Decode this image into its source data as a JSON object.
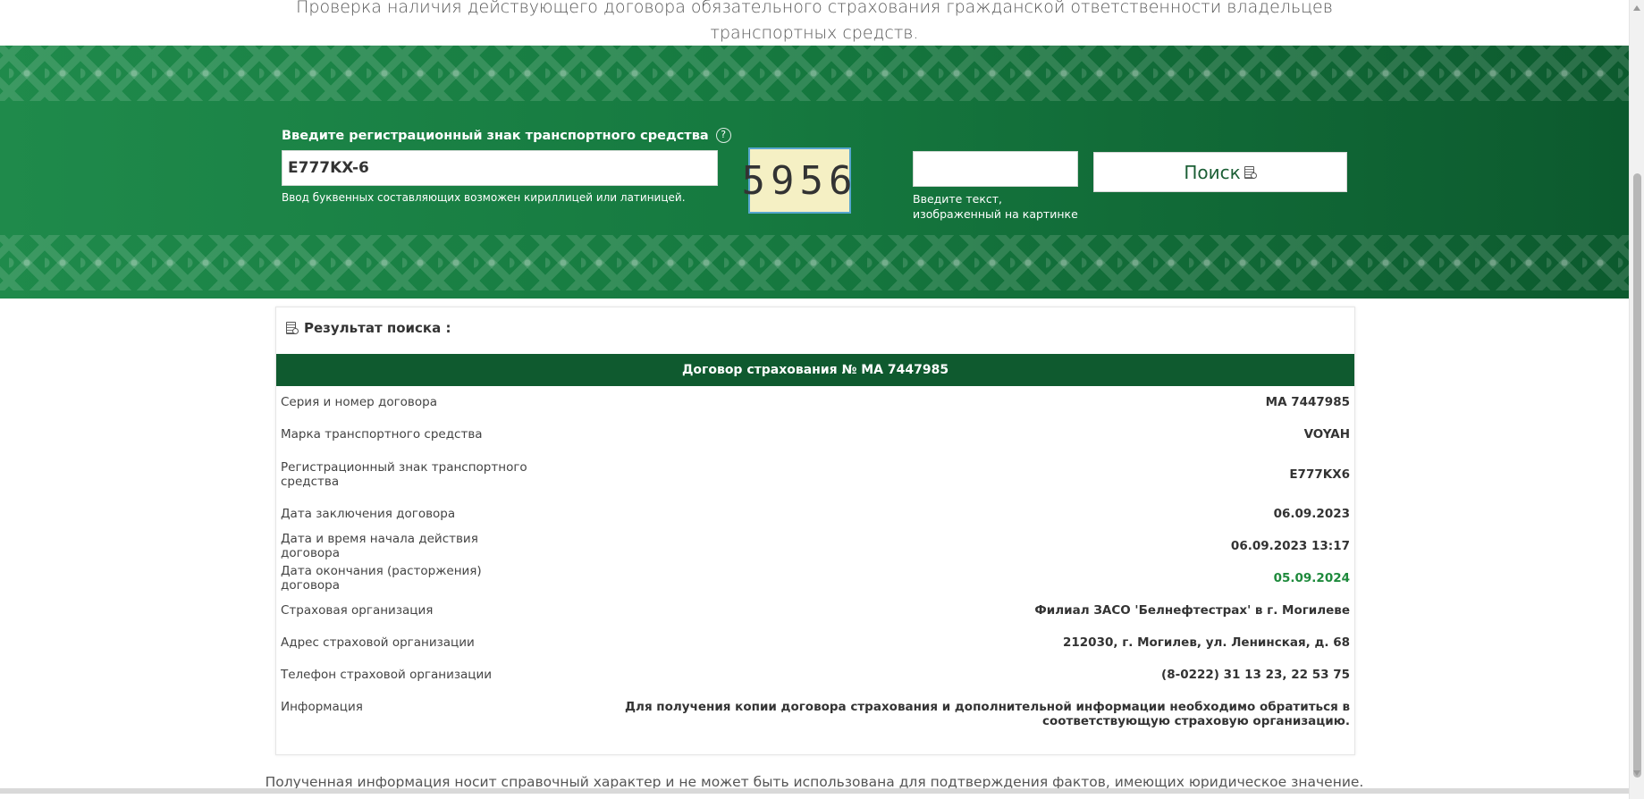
{
  "heading": {
    "line1": "Проверка наличия действующего договора обязательного страхования гражданской ответственности владельцев",
    "line2": "транспортных средств."
  },
  "search": {
    "label": "Введите регистрационный знак транспортного средства",
    "help_icon": "?",
    "reg_value": "E777KX-6",
    "reg_hint": "Ввод буквенных составляющих возможен кириллицей или латиницей.",
    "captcha_text": "5956",
    "captcha_value": "",
    "captcha_hint_1": "Введите текст,",
    "captcha_hint_2": "изображенный на картинке",
    "button_label": "Поиск",
    "button_icon": "document-search-icon"
  },
  "result": {
    "title": "Результат поиска :",
    "title_icon": "document-search-icon",
    "contract_header": "Договор страхования № МА 7447985",
    "rows": [
      {
        "label": "Серия и номер договора",
        "value": "МА 7447985"
      },
      {
        "label": "Марка транспортного средства",
        "value": "VOYAH"
      },
      {
        "label": "Регистрационный знак транспортного средства",
        "value": "E777KX6"
      },
      {
        "label": "Дата заключения договора",
        "value": "06.09.2023"
      },
      {
        "label": "Дата и время начала действия договора",
        "value": "06.09.2023 13:17"
      },
      {
        "label": "Дата окончания (расторжения) договора",
        "value": "05.09.2024"
      },
      {
        "label": "Страховая организация",
        "value": "Филиал ЗАСО 'Белнефтестрах' в г. Могилеве"
      },
      {
        "label": "Адрес страховой организации",
        "value": "212030, г. Могилев, ул. Ленинская, д. 68"
      },
      {
        "label": "Телефон страховой организации",
        "value": "(8-0222) 31 13 23, 22 53 75"
      },
      {
        "label": "Информация",
        "value": "Для получения копии договора страхования и дополнительной информации необходимо обратиться в соответствующую страховую организацию."
      }
    ]
  },
  "footer": "Полученная информация носит справочный характер и не может быть использована для подтверждения фактов, имеющих юридическое значение.",
  "colors": {
    "brand_green": "#0f5a2f",
    "banner_green": "#1f8a4b",
    "end_date_green": "#1e8a3c"
  }
}
